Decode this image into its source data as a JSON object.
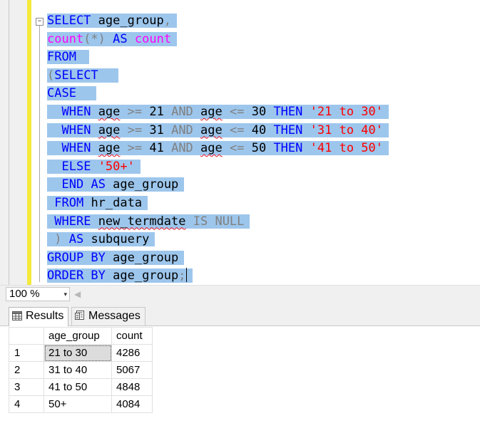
{
  "editor": {
    "fold_symbol": "−",
    "lines": [
      [
        {
          "t": "SELECT",
          "c": "kw"
        },
        {
          "t": " age_group",
          "c": "id"
        },
        {
          "t": ",",
          "c": "op"
        }
      ],
      [
        {
          "t": "count",
          "c": "fn"
        },
        {
          "t": "(*)",
          "c": "op"
        },
        {
          "t": " ",
          "c": "id"
        },
        {
          "t": "AS",
          "c": "kw"
        },
        {
          "t": " ",
          "c": "id"
        },
        {
          "t": "count",
          "c": "fn"
        }
      ],
      [
        {
          "t": "FROM",
          "c": "kw"
        },
        {
          "t": " ",
          "c": "id"
        }
      ],
      [
        {
          "t": "(",
          "c": "op"
        },
        {
          "t": "SELECT",
          "c": "kw"
        },
        {
          "t": "  ",
          "c": "id"
        }
      ],
      [
        {
          "t": "CASE",
          "c": "kw"
        },
        {
          "t": "  ",
          "c": "id"
        }
      ],
      [
        {
          "t": "  ",
          "c": "id"
        },
        {
          "t": "WHEN",
          "c": "kw"
        },
        {
          "t": " ",
          "c": "id"
        },
        {
          "t": "age",
          "c": "id",
          "sq": true
        },
        {
          "t": " >= ",
          "c": "op"
        },
        {
          "t": "21",
          "c": "id"
        },
        {
          "t": " AND ",
          "c": "op"
        },
        {
          "t": "age",
          "c": "id",
          "sq": true
        },
        {
          "t": " <= ",
          "c": "op"
        },
        {
          "t": "30",
          "c": "id"
        },
        {
          "t": " ",
          "c": "id"
        },
        {
          "t": "THEN",
          "c": "kw"
        },
        {
          "t": " ",
          "c": "id"
        },
        {
          "t": "'21 to 30'",
          "c": "str"
        }
      ],
      [
        {
          "t": "  ",
          "c": "id"
        },
        {
          "t": "WHEN",
          "c": "kw"
        },
        {
          "t": " ",
          "c": "id"
        },
        {
          "t": "age",
          "c": "id",
          "sq": true
        },
        {
          "t": " >= ",
          "c": "op"
        },
        {
          "t": "31",
          "c": "id"
        },
        {
          "t": " AND ",
          "c": "op"
        },
        {
          "t": "age",
          "c": "id",
          "sq": true
        },
        {
          "t": " <= ",
          "c": "op"
        },
        {
          "t": "40",
          "c": "id"
        },
        {
          "t": " ",
          "c": "id"
        },
        {
          "t": "THEN",
          "c": "kw"
        },
        {
          "t": " ",
          "c": "id"
        },
        {
          "t": "'31 to 40'",
          "c": "str"
        }
      ],
      [
        {
          "t": "  ",
          "c": "id"
        },
        {
          "t": "WHEN",
          "c": "kw"
        },
        {
          "t": " ",
          "c": "id"
        },
        {
          "t": "age",
          "c": "id",
          "sq": true
        },
        {
          "t": " >= ",
          "c": "op"
        },
        {
          "t": "41",
          "c": "id"
        },
        {
          "t": " AND ",
          "c": "op"
        },
        {
          "t": "age",
          "c": "id",
          "sq": true
        },
        {
          "t": " <= ",
          "c": "op"
        },
        {
          "t": "50",
          "c": "id"
        },
        {
          "t": " ",
          "c": "id"
        },
        {
          "t": "THEN",
          "c": "kw"
        },
        {
          "t": " ",
          "c": "id"
        },
        {
          "t": "'41 to 50'",
          "c": "str"
        }
      ],
      [
        {
          "t": "  ",
          "c": "id"
        },
        {
          "t": "ELSE",
          "c": "kw"
        },
        {
          "t": " ",
          "c": "id"
        },
        {
          "t": "'50+'",
          "c": "str"
        }
      ],
      [
        {
          "t": "  ",
          "c": "id"
        },
        {
          "t": "END",
          "c": "kw"
        },
        {
          "t": " ",
          "c": "id"
        },
        {
          "t": "AS",
          "c": "kw"
        },
        {
          "t": " age_group",
          "c": "id"
        }
      ],
      [
        {
          "t": " ",
          "c": "id"
        },
        {
          "t": "FROM",
          "c": "kw"
        },
        {
          "t": " hr_data",
          "c": "id"
        }
      ],
      [
        {
          "t": " ",
          "c": "id"
        },
        {
          "t": "WHERE",
          "c": "kw"
        },
        {
          "t": " ",
          "c": "id"
        },
        {
          "t": "new_termdate",
          "c": "id",
          "sq": true
        },
        {
          "t": " IS NULL",
          "c": "op"
        }
      ],
      [
        {
          "t": " ",
          "c": "id"
        },
        {
          "t": ")",
          "c": "op"
        },
        {
          "t": " ",
          "c": "id"
        },
        {
          "t": "AS",
          "c": "kw"
        },
        {
          "t": " subquery",
          "c": "id"
        }
      ],
      [
        {
          "t": "GROUP BY",
          "c": "kw"
        },
        {
          "t": " age_group",
          "c": "id"
        }
      ],
      [
        {
          "t": "ORDER BY",
          "c": "kw"
        },
        {
          "t": " age_group",
          "c": "id"
        },
        {
          "t": ";",
          "c": "op"
        }
      ]
    ]
  },
  "statusbar": {
    "zoom_value": "100 %",
    "zoom_arrow": "▾",
    "scroll_left_glyph": "◀"
  },
  "tabs": {
    "results_label": "Results",
    "messages_label": "Messages"
  },
  "results": {
    "columns": [
      "age_group",
      "count"
    ],
    "rows": [
      {
        "num": "1",
        "age_group": "21 to 30",
        "count": "4286"
      },
      {
        "num": "2",
        "age_group": "31 to 40",
        "count": "5067"
      },
      {
        "num": "3",
        "age_group": "41 to 50",
        "count": "4848"
      },
      {
        "num": "4",
        "age_group": "50+",
        "count": "4084"
      }
    ]
  },
  "colors": {
    "selection": "#9dc6ec",
    "keyword": "#0000ff",
    "function": "#ff00ff",
    "operator": "#808080",
    "string": "#ff0000",
    "change_bar": "#f5ea3c"
  }
}
